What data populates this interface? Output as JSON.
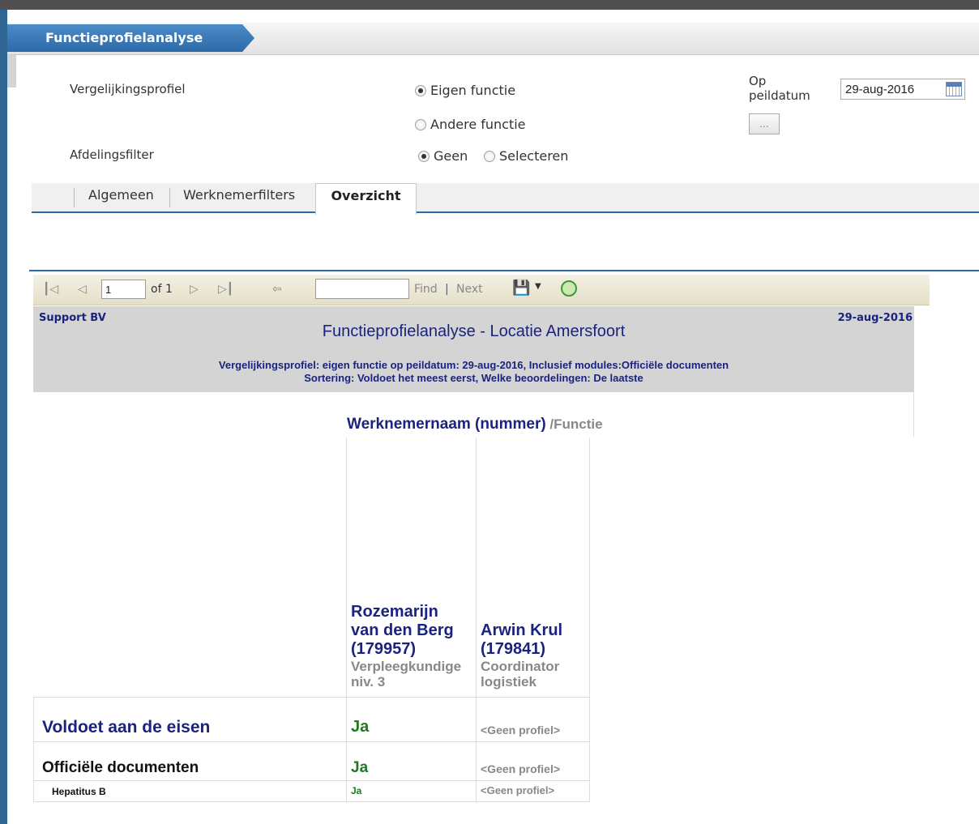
{
  "app": {
    "title": "Functieprofielanalyse"
  },
  "form": {
    "vergelijkingsprofiel_label": "Vergelijkingsprofiel",
    "radio_eigen": "Eigen functie",
    "radio_andere": "Andere functie",
    "afdelingsfilter_label": "Afdelingsfilter",
    "radio_geen": "Geen",
    "radio_selecteren": "Selecteren",
    "op_peildatum_label_1": "Op",
    "op_peildatum_label_2": "peildatum",
    "date_value": "29-aug-2016",
    "dots_button": "...",
    "eigen_checked": true,
    "geen_checked": true
  },
  "tabs": [
    "Algemeen",
    "Werknemerfilters",
    "Overzicht"
  ],
  "active_tab": "Overzicht",
  "toolbar": {
    "page_value": "1",
    "of_label": "of 1",
    "find_label": "Find",
    "separator": "|",
    "next_label": "Next"
  },
  "report": {
    "company": "Support BV",
    "date": "29-aug-2016",
    "title": "Functieprofielanalyse - Locatie Amersfoort",
    "subtitle_1": "Vergelijkingsprofiel: eigen functie op peildatum: 29-aug-2016, Inclusief modules:Officiële documenten",
    "subtitle_2": "Sortering: Voldoet het meest eerst, Welke beoordelingen: De laatste",
    "column_header": "Werknemernaam (nummer)",
    "column_header_suffix": " /Functie",
    "employees": [
      {
        "name_1": "Rozemarijn",
        "name_2": "van den Berg",
        "number": "(179957)",
        "func_1": "Verpleegkundige",
        "func_2": "niv. 3"
      },
      {
        "name_1": "Arwin Krul",
        "number": "(179841)",
        "func_1": "Coordinator",
        "func_2": "logistiek"
      }
    ],
    "rows": [
      {
        "label": "Voldoet aan de eisen",
        "values": [
          "Ja",
          "<Geen profiel>"
        ]
      },
      {
        "label": "Officiële documenten",
        "values": [
          "Ja",
          "<Geen profiel>"
        ]
      },
      {
        "label": "Hepatitus B",
        "values": [
          "Ja",
          "<Geen profiel>"
        ]
      }
    ]
  },
  "colors": {
    "accent": "#2d6aa8",
    "report_text": "#1a237e",
    "ok_green": "#1f7a1f"
  }
}
